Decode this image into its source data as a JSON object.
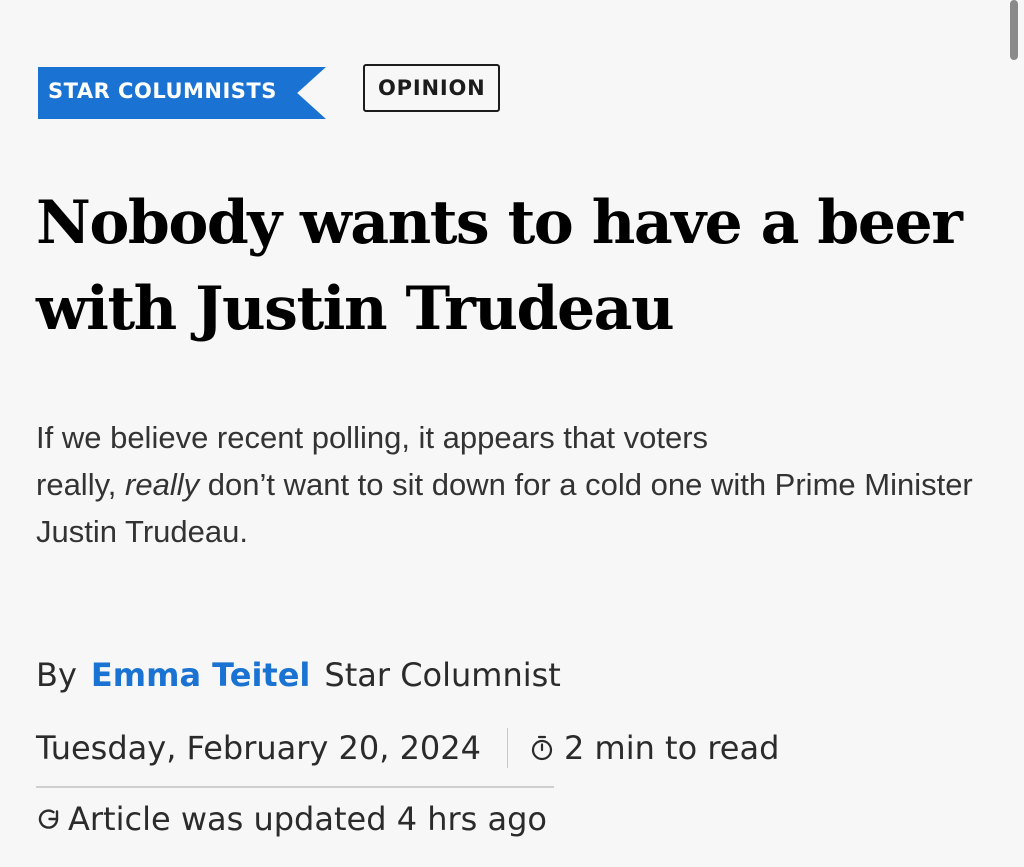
{
  "tags": {
    "section": "STAR COLUMNISTS",
    "type": "OPINION"
  },
  "article": {
    "headline_line1": "Nobody wants to have a beer",
    "headline_line2": "with Justin Trudeau",
    "deck_part1": "If we believe recent polling, it appears that voters",
    "deck_part2": "really,",
    "deck_emphasis": "really",
    "deck_part3": "don’t want to sit down for a cold one with Prime Minister Justin Trudeau."
  },
  "byline": {
    "prefix": "By",
    "author": "Emma Teitel",
    "role": "Star Columnist"
  },
  "meta": {
    "date": "Tuesday, February 20, 2024",
    "read_time": "2 min to read",
    "updated": "Article was updated 4 hrs ago",
    "icons": [
      "stopwatch-icon",
      "refresh-icon"
    ]
  },
  "colors": {
    "accent": "#1a73d3",
    "background": "#f7f7f7",
    "text": "#1c1c1c"
  }
}
